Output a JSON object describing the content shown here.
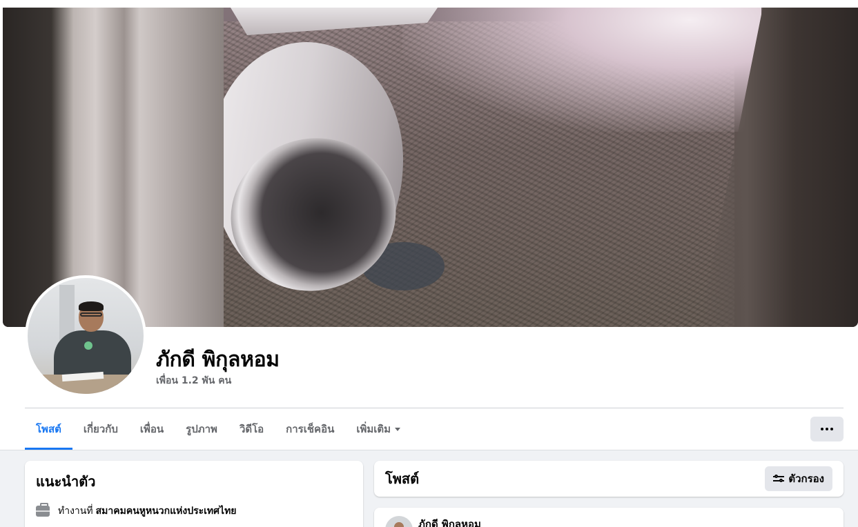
{
  "profile": {
    "name": "ภักดี พิกุลหอม",
    "friends": "เพื่อน 1.2 พัน คน"
  },
  "tabs": [
    {
      "label": "โพสต์",
      "active": true
    },
    {
      "label": "เกี่ยวกับ",
      "active": false
    },
    {
      "label": "เพื่อน",
      "active": false
    },
    {
      "label": "รูปภาพ",
      "active": false
    },
    {
      "label": "วิดีโอ",
      "active": false
    },
    {
      "label": "การเช็คอิน",
      "active": false
    },
    {
      "label": "เพิ่มเติม",
      "active": false,
      "has_dropdown": true
    }
  ],
  "more_button": {
    "icon": "more-dots-icon"
  },
  "intro": {
    "title": "แนะนำตัว",
    "work_prefix": "ทำงานที่",
    "work_org": "สมาคมคนหูหนวกแห่งประเทศไทย",
    "work_icon": "briefcase-icon"
  },
  "posts": {
    "title": "โพสต์",
    "filter_label": "ตัวกรอง",
    "filter_icon": "filter-sliders-icon",
    "first_post_author": "ภักดี พิกุลหอม"
  },
  "colors": {
    "accent": "#1877f2",
    "secondary_text": "#65676b",
    "button_bg": "#e4e6eb",
    "feed_bg": "#f0f2f5"
  }
}
